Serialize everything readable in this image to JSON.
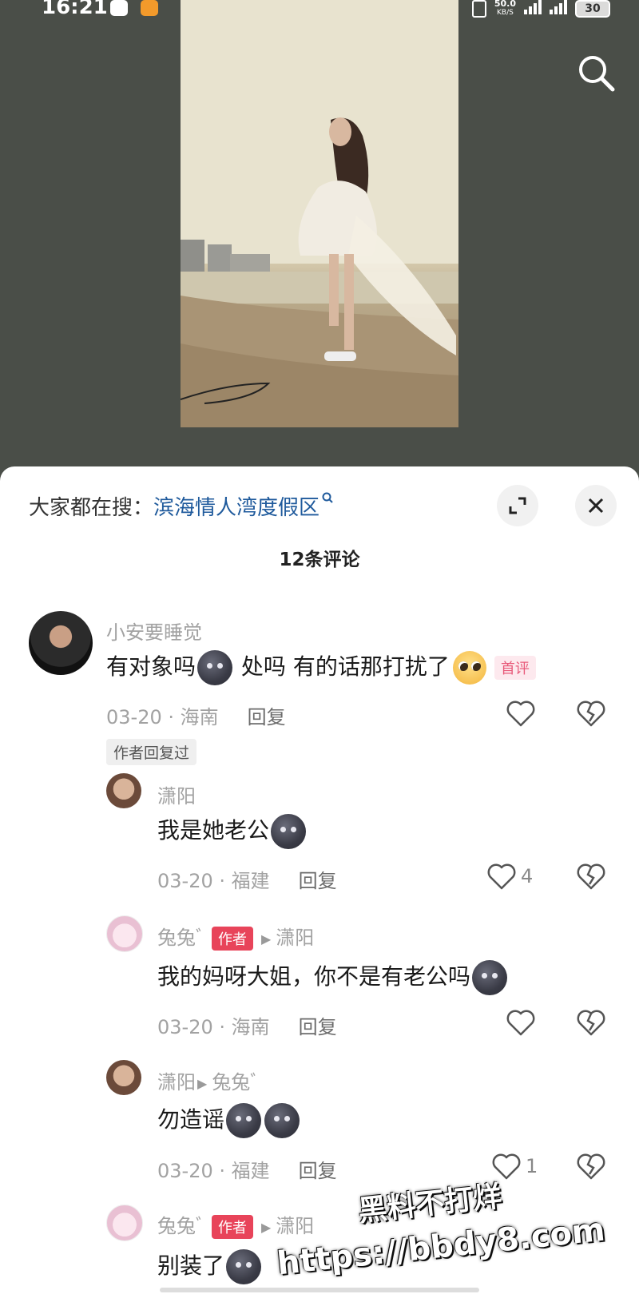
{
  "status_bar": {
    "time": "16:21",
    "net_speed_value": "50.0",
    "net_speed_unit": "KB/S",
    "battery": "30"
  },
  "suggest": {
    "prefix": "大家都在搜：",
    "query": "滨海情人湾度假区"
  },
  "comments_header": {
    "count_label": "12条评论"
  },
  "comments": [
    {
      "username": "小安要睡觉",
      "text_before": "有对象吗",
      "text_middle": "处吗 有的话那打扰了",
      "first_tag": "首评",
      "meta": "03-20 · 海南",
      "reply_label": "回复",
      "author_replied_tag": "作者回复过"
    }
  ],
  "replies": [
    {
      "username": "潇阳",
      "text": "我是她老公",
      "meta": "03-20 · 福建",
      "reply_label": "回复",
      "likes": "4"
    },
    {
      "username": "兔兔ﾞ",
      "author_tag": "作者",
      "reply_to": "潇阳",
      "text": "我的妈呀大姐，你不是有老公吗",
      "meta": "03-20 · 海南",
      "reply_label": "回复"
    },
    {
      "username": "潇阳",
      "reply_to": "兔兔ﾞ",
      "text": "勿造谣",
      "meta": "03-20 · 福建",
      "reply_label": "回复",
      "likes": "1"
    },
    {
      "username": "兔兔ﾞ",
      "author_tag": "作者",
      "reply_to": "潇阳",
      "text": "别装了"
    }
  ],
  "watermark": {
    "line1": "黑料不打烊",
    "line2": "https://bbdy8.com"
  },
  "colors": {
    "link": "#1f5a9c",
    "author_tag": "#e8445a",
    "first_tag_text": "#e85a7a",
    "background_dim": "#4a4e48"
  },
  "icons": [
    "search-icon",
    "expand-icon",
    "close-icon",
    "heart-icon",
    "broken-heart-icon",
    "moon-emoji",
    "pleading-emoji"
  ]
}
